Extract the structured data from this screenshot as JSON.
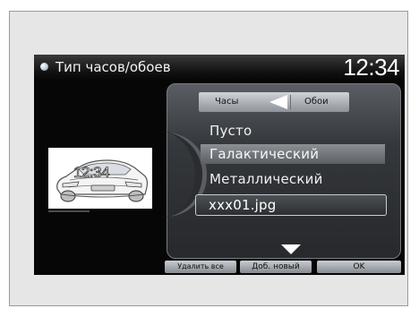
{
  "header": {
    "title": "Тип часов/обоев",
    "clock": "12:34"
  },
  "preview": {
    "clock": "12:34"
  },
  "tabs": {
    "clock_label": "Часы",
    "wallpaper_label": "Обои"
  },
  "list": {
    "items": [
      "Пусто",
      "Галактический",
      "Металлический",
      "xxx01.jpg"
    ],
    "selected_index": 3
  },
  "buttons": {
    "delete_all": "Удалить все",
    "add_new": "Доб. новый",
    "ok": "OK"
  },
  "colors": {
    "screen_background": "#060606",
    "highlight": "#8c9095",
    "text": "#f0f0f0"
  }
}
